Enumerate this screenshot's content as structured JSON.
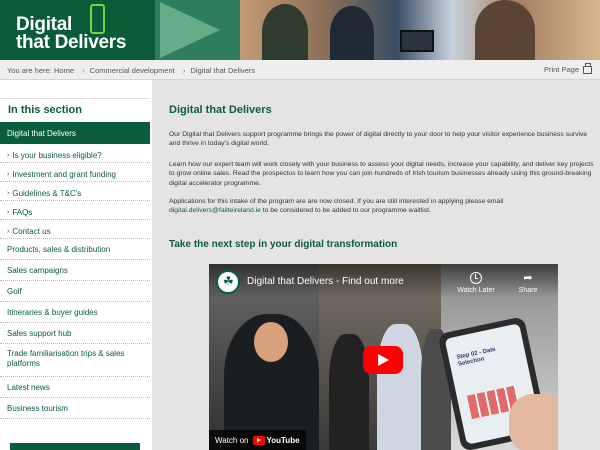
{
  "banner": {
    "logo_line1": "Digital",
    "logo_line2": "that Delivers"
  },
  "breadcrumb": {
    "you_are_here": "You are here:",
    "items": [
      "Home",
      "Commercial development",
      "Digital that Delivers"
    ],
    "separator": "›",
    "print_label": "Print Page"
  },
  "sidebar": {
    "heading": "In this section",
    "active": "Digital that Delivers",
    "subitems": [
      "Is your business eligible?",
      "Investment and grant funding",
      "Guidelines & T&C's",
      "FAQs",
      "Contact us"
    ],
    "items": [
      "Products, sales & distribution",
      "Sales campaigns",
      "Golf",
      "Itineraries & buyer guides",
      "Sales support hub",
      "Trade familiarisation trips & sales platforms",
      "Latest news",
      "Business tourism"
    ]
  },
  "main": {
    "title": "Digital that Delivers",
    "para1": "Our Digital that Delivers support programme brings the power of digital directly to your door to help your visitor experience business survive and thrive in today's digital world.",
    "para2": "Learn how our expert team will work closely with your business to assess your digital needs, increase your capability, and deliver key projects to grow online sales.  Read the prospectus to learn how you can join hundreds of Irish tourism businesses already using this ground-breaking digital accelerator programme.",
    "para3_a": "Applications for this intake of the program are are now closed. If you are still interested in applying please email",
    "para3_email": "digital.delivers@failteireland.ie",
    "para3_b": " to be considered to be added to our programme waitlist.",
    "subtitle": "Take the next step in your digital transformation"
  },
  "video": {
    "title": "Digital that Delivers - Find out more",
    "watch_later": "Watch Later",
    "share": "Share",
    "watch_on": "Watch on",
    "youtube": "YouTube",
    "phone_text": "Step 02 - Date Selection"
  },
  "colors": {
    "brand_green": "#0b5d3b",
    "accent_green": "#7fd13b",
    "youtube_red": "#ff0000"
  }
}
